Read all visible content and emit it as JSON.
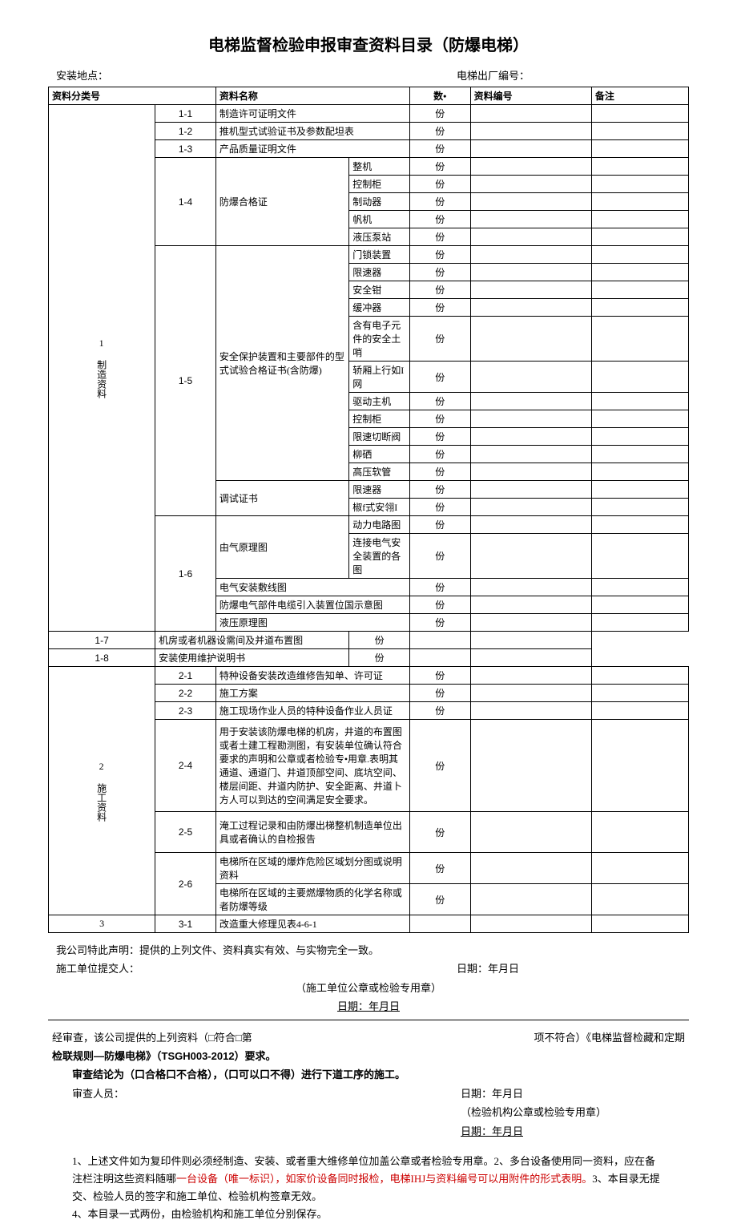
{
  "title": "电梯监督检验申报审查资料目录（防爆电梯）",
  "header": {
    "loc_label": "安装地点：",
    "sn_label": "电梯出厂编号："
  },
  "th": {
    "cat": "资料分类号",
    "name": "资料名称",
    "qty": "数•",
    "code": "资料编号",
    "note": "备注"
  },
  "unit": "份",
  "sec1": {
    "label": "1 制造资料",
    "r11_num": "1-1",
    "r11": "制造许可证明文件",
    "r12_num": "1-2",
    "r12": "推机型式试验证书及参数配坦表",
    "r13_num": "1-3",
    "r13": "产品质量证明文件",
    "r14_num": "1-4",
    "r14_label": "防爆合格证",
    "r14_a": "整机",
    "r14_b": "控制柜",
    "r14_c": "制动器",
    "r14_d": "帆机",
    "r14_e": "液压泵站",
    "r15_num": "1-5",
    "r15_label1": "安全保护装置和主要部件的型式试验合格证书(含防爆)",
    "r15_a": "门锁装置",
    "r15_b": "限速器",
    "r15_c": "安全钳",
    "r15_d": "缓冲器",
    "r15_e": "含有电子元件的安全土哨",
    "r15_f": "轿厢上行如I网",
    "r15_g": "驱动主机",
    "r15_h": "控制柜",
    "r15_i": "限速切断阀",
    "r15_j": "柳硒",
    "r15_k": "高压软管",
    "r15_label2": "调试证书",
    "r15_l": "限速器",
    "r15_m": "椒f式安翎I",
    "r16_num": "1-6",
    "r16_label": "由气原理图",
    "r16_a": "动力电路图",
    "r16_b": "连接电气安全装置的各图",
    "r16_c": "电气安装敷线图",
    "r16_d": "防爆电气部件电缆引入装置位国示意图",
    "r16_e": "液压原理图",
    "r17_num": "1-7",
    "r17": "机房或者机器设需间及并道布置图",
    "r18_num": "1-8",
    "r18": "安装使用维护说明书"
  },
  "sec2": {
    "label": "2 施工资料",
    "r21_num": "2-1",
    "r21": "特种设备安装改造维修告知单、许可证",
    "r22_num": "2-2",
    "r22": "施工方案",
    "r23_num": "2-3",
    "r23": "施工现场作业人员的特种设备作业人员证",
    "r24_num": "2-4",
    "r24": "用于安装该防爆电梯的机房，井道的布置图或者土建工程勘测图，有安装单位确认符合要求的声明和公章或者检验专•用章.表明其通道、通道门、井道顶部空间、底坑空间、楼层间距、井道内防护、安全距离、井道卜方人可以到达的空间满足安全要求。",
    "r25_num": "2-5",
    "r25": "淹工过程记录和由防爆出梯整机制造单位出具或者确认的自检报告",
    "r26_num": "2-6",
    "r26_a": "电梯所在区域的爆炸危险区域划分图或说明资料",
    "r26_b": "电梯所在区域的主要燃爆物质的化学名称或者防爆等级"
  },
  "sec3": {
    "num": "3",
    "r31_num": "3-1",
    "r31": "改造重大修理见表4-6-1"
  },
  "state": {
    "l1": "我公司特此声明：提供的上列文件、资料真实有效、与实物完全一致。",
    "l2a": "施工单位提交人：",
    "l2b": "日期：年月日",
    "l3": "（施工单位公章或检验专用章）",
    "l4": "日期：年月日"
  },
  "review": {
    "l1a": "经审查，该公司提供的上列资料（□符合□第",
    "l1b": "项不符合）《电梯监督检藏和定期",
    "l2": "检联规则—防爆电梯》（TSGH003-2012）要求。",
    "l3": "审查结论为（口合格口不合格），（口可以口不得）进行下道工序的施工。",
    "l4a": "审查人员：",
    "l4b": "日期：年月日",
    "l5": "（检验机构公章或检验专用章）",
    "l6": "日期：年月日"
  },
  "notes": {
    "p1a": "1、上述文件如为复印件则必须经制造、安装、或者重大维修单位加盖公章或者检验专用章。2、多台设备使用同一资料，应在备注栏注明这些资料随哪",
    "p1b": "一台设备（唯一标识），如家价设备同时报检，电梯IHJ与资料编号可以用附件的形式表明。",
    "p1c": "3、本目录无提交、检验人员的签字和施工单位、检验机构签章无效。",
    "p2": "4、本目录一式两份，由检验机构和施工单位分别保存。"
  }
}
